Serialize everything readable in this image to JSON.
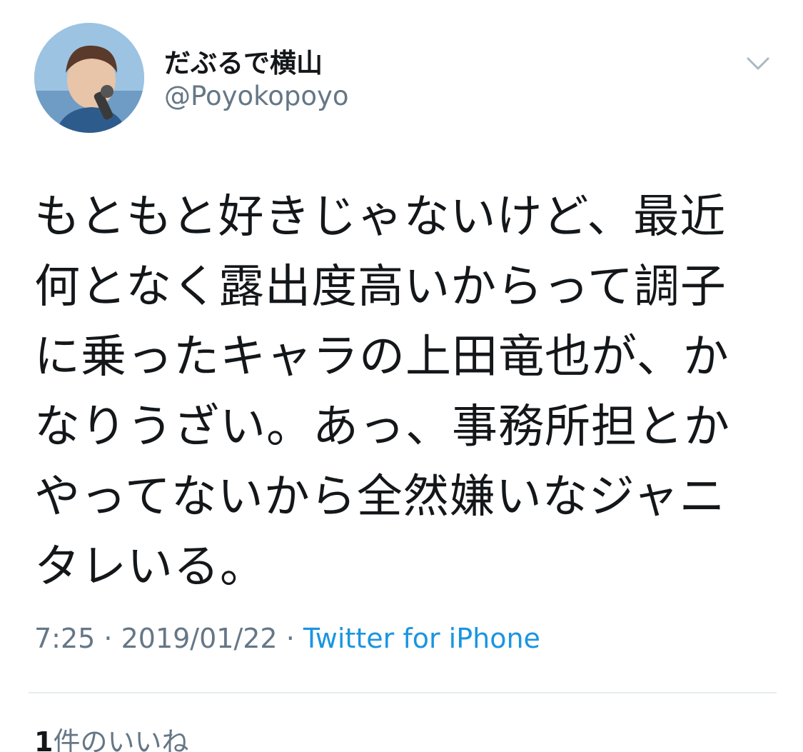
{
  "user": {
    "display_name": "だぶるで横山",
    "handle": "@Poyokopoyo",
    "avatar_icon": "user-avatar-photo"
  },
  "header": {
    "menu_icon": "chevron-down-icon"
  },
  "tweet": {
    "lines": [
      "もともと好きじゃないけど、最近",
      "何となく露出度高いからって調子",
      "に乗ったキャラの上田竜也が、か",
      "なりうざい。あっ、事務所担とか",
      "やってないから全然嫌いなジャニ",
      "タレいる。"
    ]
  },
  "meta": {
    "time": "7:25",
    "separator": " · ",
    "date": "2019/01/22",
    "source": "Twitter for iPhone"
  },
  "likes": {
    "count": "1",
    "label": "件のいいね"
  },
  "colors": {
    "text": "#14171a",
    "secondary": "#657786",
    "link": "#1b95e0",
    "divider": "#e6ecf0"
  }
}
